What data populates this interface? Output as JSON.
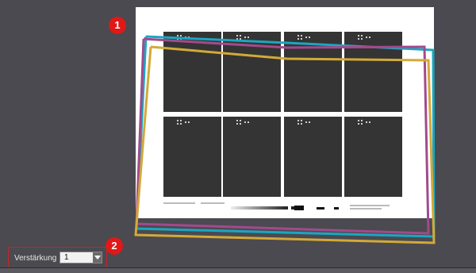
{
  "badges": {
    "one": "1",
    "two": "2"
  },
  "gain_control": {
    "label": "Verstärkung",
    "value": "1"
  },
  "overlay_colors": {
    "cyan": "#1aa7c0",
    "magenta": "#a24a8c",
    "yellow": "#d3a938",
    "badge": "#e01818"
  }
}
